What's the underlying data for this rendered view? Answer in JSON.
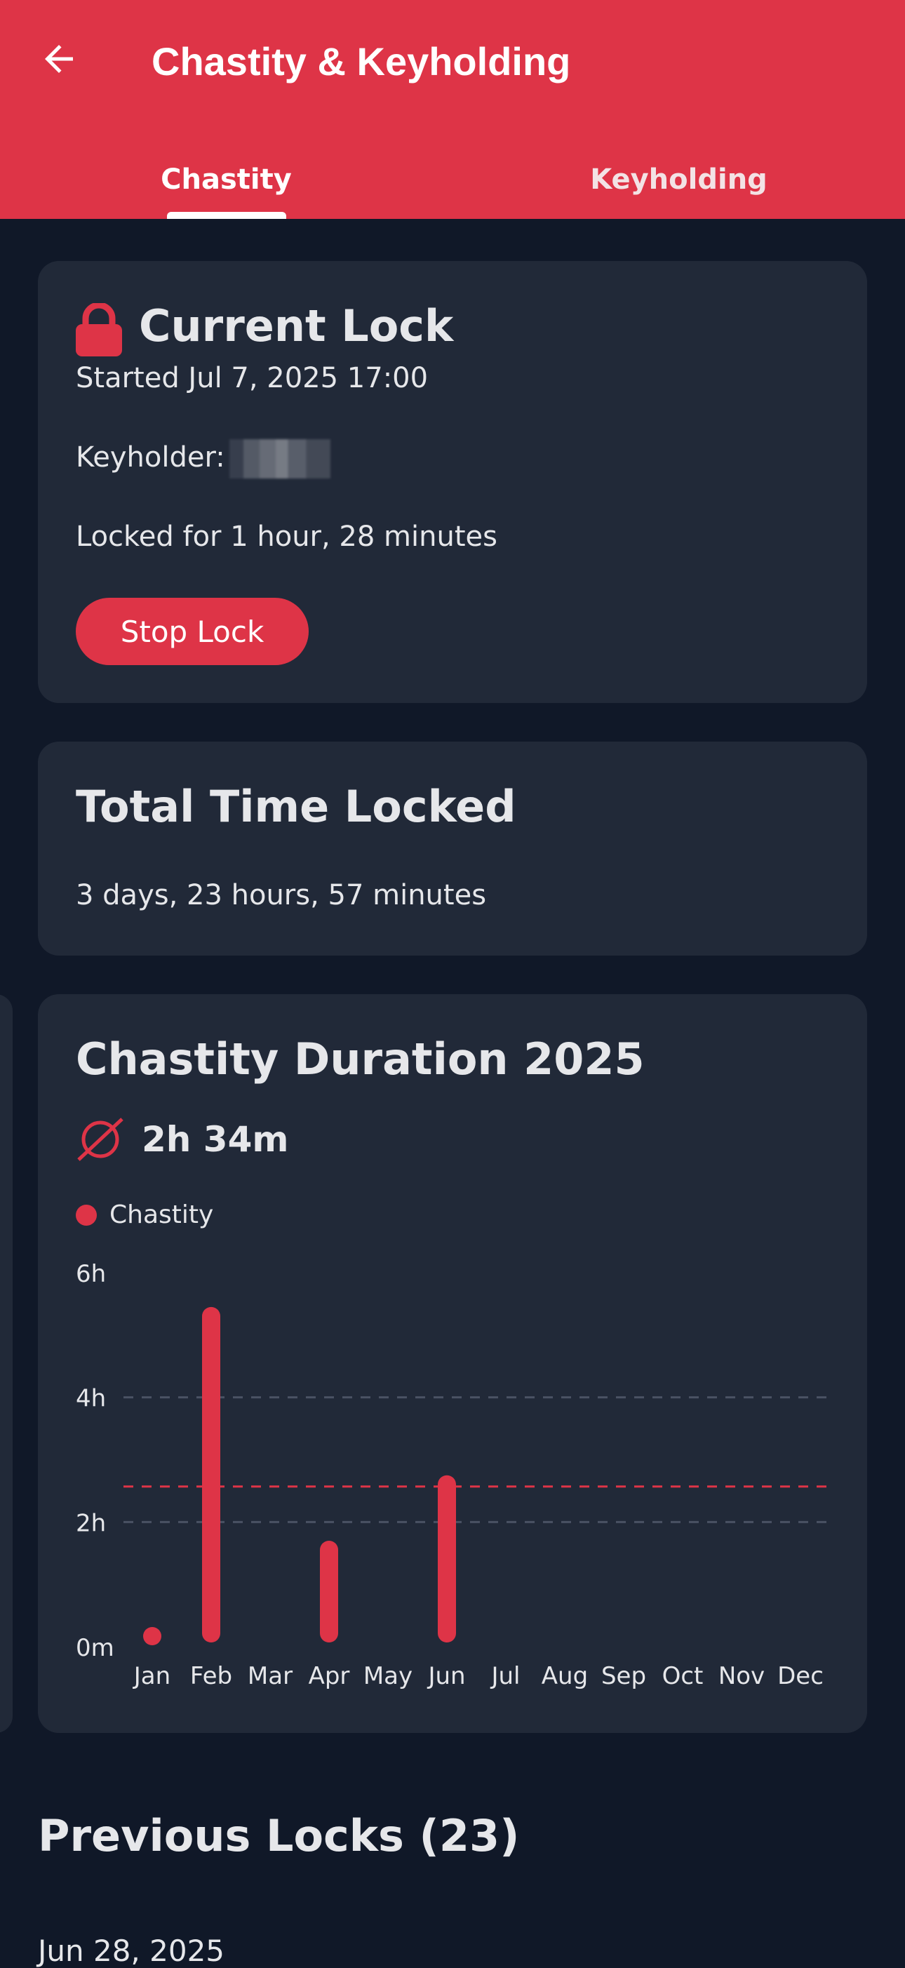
{
  "appbar": {
    "title": "Chastity & Keyholding",
    "back_icon": "arrow-left-icon",
    "background": "#DE3447"
  },
  "tabs": [
    {
      "label": "Chastity",
      "selected": true
    },
    {
      "label": "Keyholding",
      "selected": false
    }
  ],
  "current_lock": {
    "title": "Current Lock",
    "icon": "lock-icon",
    "started": "Started Jul 7, 2025 17:00",
    "keyholder_label": "Keyholder:",
    "locked_for": "Locked for 1 hour, 28 minutes",
    "stop_button": "Stop Lock"
  },
  "total_time": {
    "title": "Total Time Locked",
    "value": "3 days, 23 hours, 57 minutes"
  },
  "duration_chart": {
    "title": "Chastity Duration 2025",
    "average_icon": "average-icon",
    "average_value": "2h 34m",
    "legend_label": "Chastity"
  },
  "previous_locks": {
    "title": "Previous Locks (23)",
    "first_date": "Jun 28, 2025"
  },
  "colors": {
    "accent": "#DE3447",
    "background": "#101828",
    "card": "#212938",
    "text": "#E6E7EA",
    "gridline": "#4A5263"
  },
  "chart_data": {
    "type": "bar",
    "title": "Chastity Duration 2025",
    "categories": [
      "Jan",
      "Feb",
      "Mar",
      "Apr",
      "May",
      "Jun",
      "Jul",
      "Aug",
      "Sep",
      "Oct",
      "Nov",
      "Dec"
    ],
    "series": [
      {
        "name": "Chastity",
        "values": [
          0.0,
          5.45,
          0,
          1.7,
          0,
          2.75,
          0,
          0,
          0,
          0,
          0,
          0
        ]
      }
    ],
    "y_tick_labels": [
      "0m",
      "2h",
      "4h",
      "6h"
    ],
    "y_ticks": [
      0,
      2,
      4,
      6
    ],
    "ylim": [
      0,
      6
    ],
    "average_hours": 2.57,
    "average_line_color": "#DE3447",
    "grid": true,
    "legend": "top-left",
    "xlabel": "",
    "ylabel": ""
  }
}
